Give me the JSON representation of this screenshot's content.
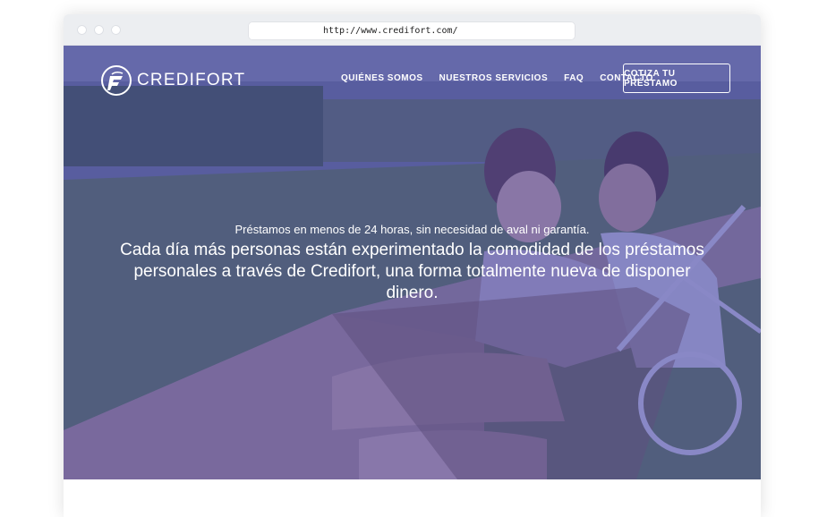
{
  "browser": {
    "url": "http://www.credifort.com/"
  },
  "header": {
    "logo_text": "CREDIFORT",
    "nav": [
      {
        "label": "QUIÉNES SOMOS"
      },
      {
        "label": "NUESTROS SERVICIOS"
      },
      {
        "label": "FAQ"
      },
      {
        "label": "CONTACTO"
      }
    ],
    "cta_label": "COTIZA TU PRÉSTAMO"
  },
  "hero": {
    "subtitle": "Préstamos en menos de 24 horas, sin necesidad de aval ni garantía.",
    "headline": "Cada día más personas están experimentado la comodidad de los préstamos personales a través de Credifort, una forma totalmente nueva de disponer dinero."
  },
  "colors": {
    "overlay": "#3a37a0",
    "text": "#ffffff"
  }
}
